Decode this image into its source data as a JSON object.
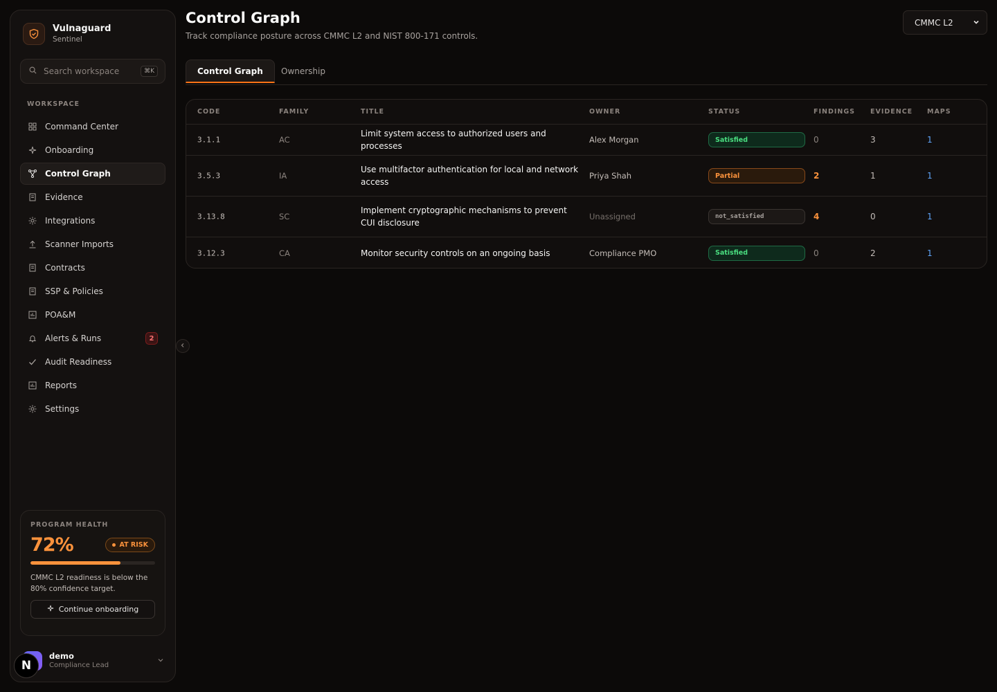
{
  "brand": {
    "name": "Vulnaguard",
    "sub": "Sentinel"
  },
  "search": {
    "placeholder": "Search workspace",
    "shortcut": "⌘K"
  },
  "sidebar": {
    "section": "WORKSPACE",
    "items": [
      {
        "label": "Command Center",
        "icon": "grid-icon"
      },
      {
        "label": "Onboarding",
        "icon": "sparkle-icon"
      },
      {
        "label": "Control Graph",
        "icon": "graph-icon",
        "active": true
      },
      {
        "label": "Evidence",
        "icon": "document-icon"
      },
      {
        "label": "Integrations",
        "icon": "sun-icon"
      },
      {
        "label": "Scanner Imports",
        "icon": "upload-icon"
      },
      {
        "label": "Contracts",
        "icon": "document-icon"
      },
      {
        "label": "SSP & Policies",
        "icon": "document-icon"
      },
      {
        "label": "POA&M",
        "icon": "chart-icon"
      },
      {
        "label": "Alerts & Runs",
        "icon": "bell-icon",
        "badge": "2"
      },
      {
        "label": "Audit Readiness",
        "icon": "check-icon"
      },
      {
        "label": "Reports",
        "icon": "chart-icon"
      },
      {
        "label": "Settings",
        "icon": "gear-icon"
      }
    ]
  },
  "health": {
    "label": "PROGRAM HEALTH",
    "percent": "72%",
    "progress": 0.72,
    "status": "AT RISK",
    "description": "CMMC L2 readiness is below the 80% confidence target.",
    "button": "Continue onboarding"
  },
  "user": {
    "name": "demo",
    "role": "Compliance Lead",
    "floating_letter": "N"
  },
  "header": {
    "title": "Control Graph",
    "subtitle": "Track compliance posture across CMMC L2 and NIST 800-171 controls.",
    "framework": "CMMC L2"
  },
  "tabs": [
    "Control Graph",
    "Ownership"
  ],
  "table": {
    "columns": [
      "CODE",
      "FAMILY",
      "TITLE",
      "OWNER",
      "STATUS",
      "FINDINGS",
      "EVIDENCE",
      "MAPS"
    ],
    "rows": [
      {
        "code": "3.1.1",
        "family": "AC",
        "title": "Limit system access to authorized users and processes",
        "owner": "Alex Morgan",
        "status": "Satisfied",
        "findings": "0",
        "evidence": "3",
        "maps": "1"
      },
      {
        "code": "3.5.3",
        "family": "IA",
        "title": "Use multifactor authentication for local and network access",
        "owner": "Priya Shah",
        "status": "Partial",
        "findings": "2",
        "evidence": "1",
        "maps": "1"
      },
      {
        "code": "3.13.8",
        "family": "SC",
        "title": "Implement cryptographic mechanisms to prevent CUI disclosure",
        "owner": "Unassigned",
        "status": "not_satisfied",
        "findings": "4",
        "evidence": "0",
        "maps": "1"
      },
      {
        "code": "3.12.3",
        "family": "CA",
        "title": "Monitor security controls on an ongoing basis",
        "owner": "Compliance PMO",
        "status": "Satisfied",
        "findings": "0",
        "evidence": "2",
        "maps": "1"
      }
    ]
  },
  "colors": {
    "accent": "#f97316",
    "success": "#4ade80",
    "warning": "#fb923c",
    "link": "#60a5fa",
    "danger": "#f87171"
  }
}
